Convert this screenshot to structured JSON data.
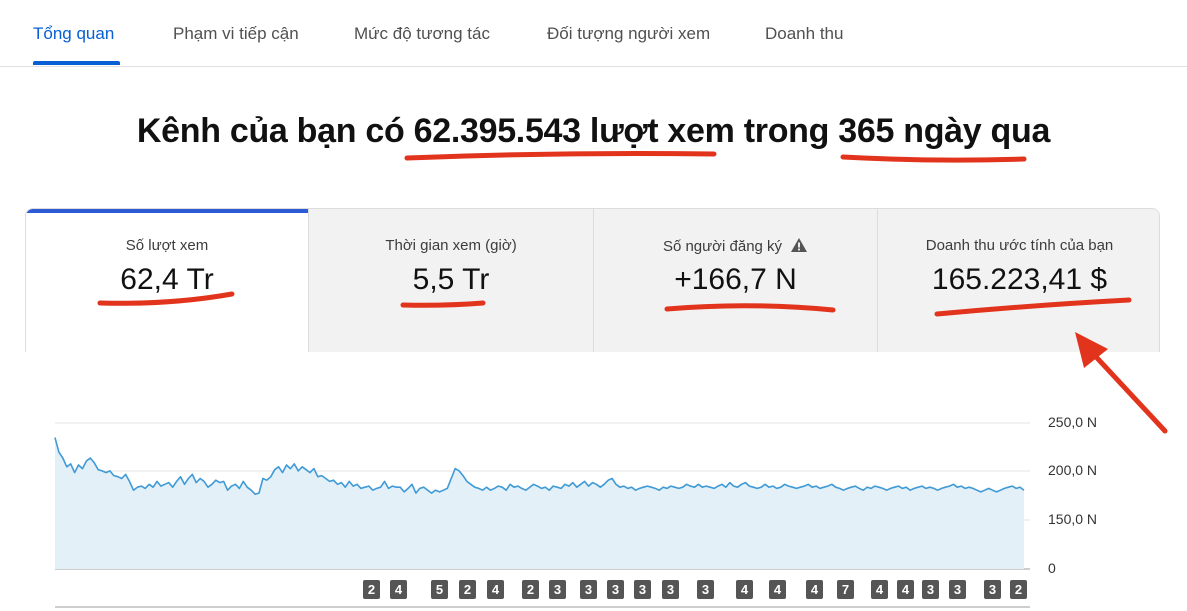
{
  "tabs": [
    {
      "label": "Tổng quan"
    },
    {
      "label": "Phạm vi tiếp cận"
    },
    {
      "label": "Mức độ tương tác"
    },
    {
      "label": "Đối tượng người xem"
    },
    {
      "label": "Doanh thu"
    }
  ],
  "headline": {
    "prefix": "Kênh của bạn có ",
    "views": "62.395.543 lượt xem",
    "middle": " trong ",
    "period": "365 ngày qua"
  },
  "metrics": [
    {
      "label": "Số lượt xem",
      "value": "62,4 Tr"
    },
    {
      "label": "Thời gian xem (giờ)",
      "value": "5,5 Tr"
    },
    {
      "label": "Số người đăng ký",
      "value": "+166,7 N",
      "icon": "warning-icon"
    },
    {
      "label": "Doanh thu ước tính của bạn",
      "value": "165.223,41 $"
    }
  ],
  "colors": {
    "accent": "#065fd4",
    "card_active_bar": "#2d5bd6",
    "series_line": "#3f9ad6",
    "series_fill": "#e3f0f8",
    "annotation": "#e2341d"
  },
  "chart_data": {
    "type": "area",
    "y_tick_labels": [
      "250,0 N",
      "200,0 N",
      "150,0 N",
      "0"
    ],
    "ylim": [
      0,
      250
    ],
    "grid": true,
    "series": [
      {
        "values": [
          225,
          200,
          190,
          175,
          180,
          165,
          178,
          172,
          185,
          190,
          182,
          170,
          168,
          165,
          168,
          160,
          158,
          155,
          162,
          150,
          135,
          140,
          142,
          138,
          145,
          140,
          150,
          142,
          145,
          148,
          140,
          150,
          158,
          145,
          155,
          162,
          148,
          155,
          150,
          140,
          145,
          152,
          148,
          150,
          135,
          142,
          145,
          138,
          150,
          140,
          135,
          128,
          130,
          155,
          152,
          158,
          170,
          175,
          165,
          178,
          172,
          180,
          168,
          175,
          170,
          165,
          172,
          158,
          160,
          155,
          150,
          152,
          145,
          148,
          140,
          150,
          142,
          145,
          138,
          140,
          142,
          135,
          138,
          140,
          150,
          138,
          142,
          140,
          140,
          132,
          138,
          145,
          130,
          138,
          140,
          135,
          130,
          135,
          132,
          135,
          138,
          155,
          172,
          168,
          160,
          150,
          145,
          140,
          138,
          135,
          140,
          135,
          138,
          142,
          140,
          135,
          145,
          140,
          142,
          138,
          135,
          140,
          145,
          142,
          138,
          140,
          135,
          142,
          140,
          138,
          145,
          142,
          148,
          140,
          145,
          150,
          142,
          148,
          145,
          140,
          145,
          152,
          155,
          145,
          140,
          142,
          138,
          140,
          135,
          138,
          140,
          142,
          140,
          138,
          135,
          140,
          138,
          142,
          140,
          138,
          140,
          145,
          142,
          140,
          145,
          140,
          142,
          140,
          138,
          142,
          145,
          140,
          148,
          142,
          140,
          145,
          148,
          142,
          140,
          138,
          140,
          145,
          140,
          142,
          138,
          140,
          145,
          142,
          140,
          138,
          140,
          142,
          145,
          140,
          142,
          138,
          140,
          142,
          145,
          140,
          138,
          135,
          138,
          140,
          142,
          138,
          135,
          140,
          138,
          142,
          140,
          138,
          135,
          138,
          140,
          142,
          138,
          140,
          135,
          138,
          140,
          142,
          138,
          140,
          138,
          135,
          138,
          140,
          142,
          145,
          140,
          142,
          138,
          140,
          138,
          135,
          132,
          135,
          138,
          135,
          132,
          135,
          138,
          140,
          142,
          138,
          140,
          135
        ]
      }
    ]
  },
  "badges": [
    "2",
    "4",
    "5",
    "2",
    "4",
    "2",
    "3",
    "3",
    "3",
    "3",
    "3",
    "3",
    "4",
    "4",
    "4",
    "7",
    "4",
    "4",
    "3",
    "3",
    "3",
    "2"
  ]
}
